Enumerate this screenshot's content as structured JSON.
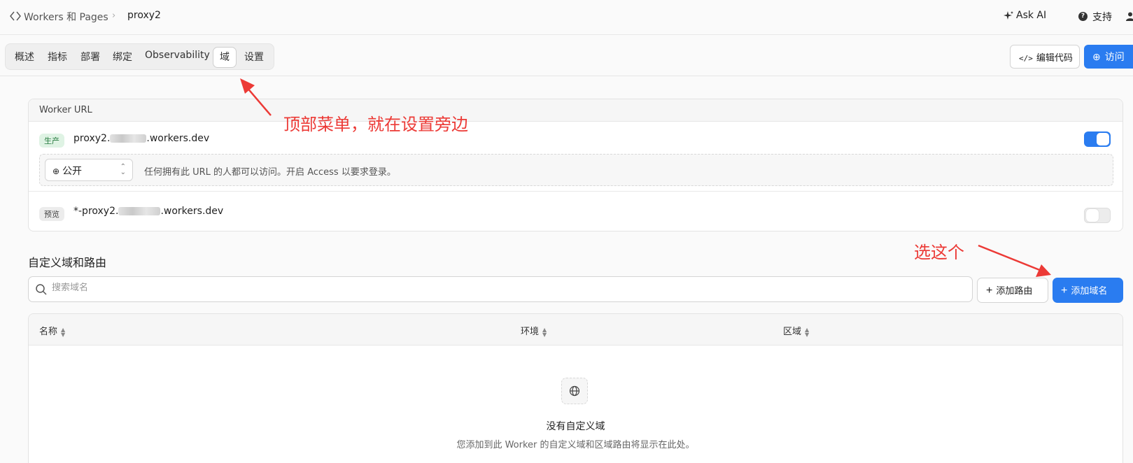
{
  "breadcrumb": {
    "root": "Workers 和 Pages",
    "current": "proxy2"
  },
  "header": {
    "ask_ai": "Ask AI",
    "support": "支持"
  },
  "tabs": [
    {
      "label": "概述"
    },
    {
      "label": "指标"
    },
    {
      "label": "部署"
    },
    {
      "label": "绑定"
    },
    {
      "label": "Observability"
    },
    {
      "label": "域",
      "active": true
    },
    {
      "label": "设置"
    }
  ],
  "actions": {
    "edit_code": "编辑代码",
    "visit": "访问"
  },
  "worker_url": {
    "title": "Worker URL",
    "production": {
      "badge": "生产",
      "url_prefix": "proxy2.",
      "url_suffix": ".workers.dev",
      "enabled": true
    },
    "visibility": {
      "selected": "公开",
      "description": "任何拥有此 URL 的人都可以访问。开启 Access 以要求登录。"
    },
    "preview": {
      "badge": "预览",
      "url_prefix": "*-proxy2.",
      "url_suffix": ".workers.dev",
      "enabled": false
    }
  },
  "custom_domains": {
    "title": "自定义域和路由",
    "search_placeholder": "搜索域名",
    "add_route": "添加路由",
    "add_domain": "添加域名",
    "columns": [
      "名称",
      "环境",
      "区域"
    ],
    "empty_title": "没有自定义域",
    "empty_description": "您添加到此 Worker 的自定义域和区域路由将显示在此处。"
  },
  "annotations": {
    "menu_note": "顶部菜单，就在设置旁边",
    "select_note": "选这个",
    "color": "#ec3a36"
  },
  "colors": {
    "primary": "#2a7cf0",
    "production_badge": "#dff3e4"
  }
}
